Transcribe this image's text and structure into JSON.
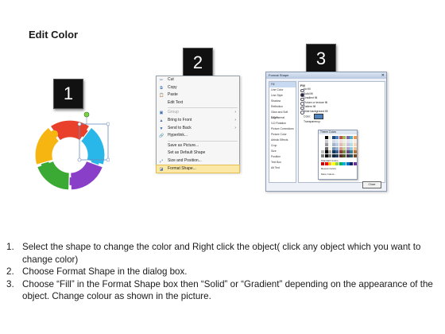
{
  "title": "Edit Color",
  "badges": {
    "one": "1",
    "two": "2",
    "three": "3"
  },
  "context_menu": {
    "items": [
      {
        "label": "Cut",
        "icon": "scissors-icon",
        "glyph": "✂"
      },
      {
        "label": "Copy",
        "icon": "copy-icon",
        "glyph": "⧉"
      },
      {
        "label": "Paste",
        "icon": "paste-icon",
        "glyph": "📋"
      },
      {
        "label": "Edit Text",
        "icon": "edit-text-icon",
        "glyph": ""
      },
      {
        "label": "Group",
        "icon": "group-icon",
        "glyph": "▣"
      },
      {
        "label": "Bring to Front",
        "icon": "bring-front-icon",
        "glyph": "▲"
      },
      {
        "label": "Send to Back",
        "icon": "send-back-icon",
        "glyph": "▼"
      },
      {
        "label": "Hyperlink...",
        "icon": "hyperlink-icon",
        "glyph": "🔗"
      },
      {
        "label": "Save as Picture...",
        "icon": "save-picture-icon",
        "glyph": ""
      },
      {
        "label": "Set as Default Shape",
        "icon": "default-shape-icon",
        "glyph": ""
      },
      {
        "label": "Size and Position...",
        "icon": "size-position-icon",
        "glyph": "⤢"
      },
      {
        "label": "Format Shape...",
        "icon": "format-shape-icon",
        "glyph": "◪"
      }
    ]
  },
  "format_dialog": {
    "title": "Format Shape",
    "close_glyph": "✕",
    "categories": [
      "Fill",
      "Line Color",
      "Line Style",
      "Shadow",
      "Reflection",
      "Glow and Soft Edges",
      "3-D Format",
      "3-D Rotation",
      "Picture Corrections",
      "Picture Color",
      "Artistic Effects",
      "Crop",
      "Size",
      "Position",
      "Text Box",
      "Alt Text"
    ],
    "fill_heading": "Fill",
    "fill_options": [
      "No fill",
      "Solid fill",
      "Gradient fill",
      "Picture or texture fill",
      "Pattern fill",
      "Slide background fill"
    ],
    "color_label": "Color:",
    "transparency_label": "Transparency:",
    "close_button": "Close"
  },
  "palette": {
    "theme_label": "Theme Colors",
    "standard_label": "Standard Colors",
    "recent_label": "Recent Colors",
    "more_label": "More Colors...",
    "theme_top": [
      "#ffffff",
      "#000000",
      "#eeece1",
      "#1f497d",
      "#4f81bd",
      "#c0504d",
      "#9bbb59",
      "#8064a2",
      "#4bacc6",
      "#f79646"
    ],
    "standard": [
      "#c00000",
      "#ff0000",
      "#ffc000",
      "#ffff00",
      "#92d050",
      "#00b050",
      "#00b0f0",
      "#0070c0",
      "#002060",
      "#7030a0"
    ],
    "accent": "#4f81bd"
  },
  "steps": [
    {
      "num": "1.",
      "text": "Select the shape to change the color and Right click the object( click any object which you want to change color)"
    },
    {
      "num": "2.",
      "text": "Choose Format Shape in the dialog box."
    },
    {
      "num": "3.",
      "text": "Choose “Fill” in the Format Shape box then “Solid” or “Gradient” depending on the appearance of the object. Change colour as shown in the picture."
    }
  ],
  "ring_colors": [
    "#e8402a",
    "#29b6e8",
    "#8a3fc9",
    "#3aaa35",
    "#f7b512"
  ]
}
